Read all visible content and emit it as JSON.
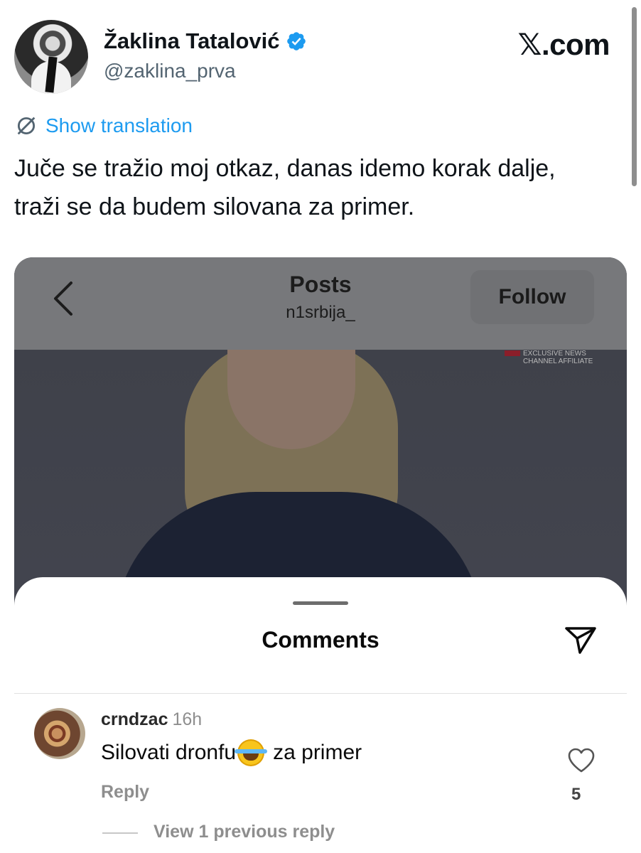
{
  "tweet": {
    "display_name": "Žaklina Tatalović",
    "handle": "@zaklina_prva",
    "verified": true,
    "brand": "𝕏.com",
    "translate_label": "Show translation",
    "text": "Juče se tražio moj otkaz, danas idemo korak dalje, traži se da budem silovana za primer.",
    "accent_color": "#1d9bf0"
  },
  "embed": {
    "header_title": "Posts",
    "header_subtitle": "n1srbija_",
    "follow_label": "Follow",
    "watermark_line1": "EXCLUSIVE NEWS",
    "watermark_line2": "CHANNEL AFFILIATE",
    "sheet_title": "Comments",
    "comment": {
      "username": "crndzac",
      "time": "16h",
      "text_before": "Silovati dronfu",
      "emoji": "face-with-tears-of-joy",
      "text_after": "za primer",
      "reply_label": "Reply",
      "likes": "5",
      "view_replies_label": "View 1 previous reply"
    }
  }
}
